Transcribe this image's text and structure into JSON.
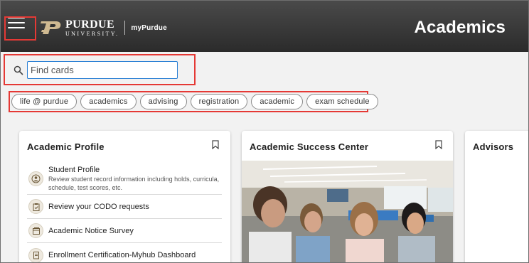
{
  "header": {
    "logo_line1": "PURDUE",
    "logo_line2": "UNIVERSITY.",
    "logo_sub": "myPurdue",
    "page_title": "Academics"
  },
  "search": {
    "placeholder": "Find cards",
    "value": ""
  },
  "chips": [
    "life @ purdue",
    "academics",
    "advising",
    "registration",
    "academic",
    "exam schedule"
  ],
  "cards": {
    "academic_profile": {
      "title": "Academic Profile",
      "items": [
        {
          "title": "Student Profile",
          "description": "Review student record information including holds, curricula, schedule, test scores, etc.",
          "icon": "person-icon"
        },
        {
          "title": "Review your CODO requests",
          "icon": "clipboard-icon"
        },
        {
          "title": "Academic Notice Survey",
          "icon": "window-icon"
        },
        {
          "title": "Enrollment Certification-Myhub Dashboard",
          "icon": "document-icon"
        }
      ]
    },
    "success_center": {
      "title": "Academic Success Center"
    },
    "advisors": {
      "title": "Advisors"
    }
  },
  "colors": {
    "header_bg": "#2f2f2f",
    "highlight": "#e53935",
    "input_focus": "#2a7fd4",
    "purdue_gold": "#cfb991"
  }
}
